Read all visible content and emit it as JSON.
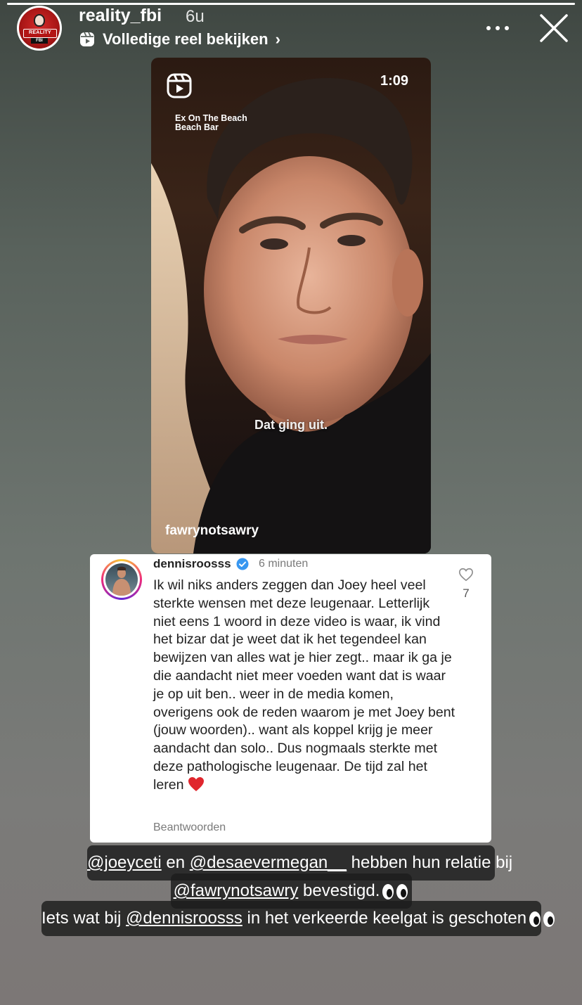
{
  "header": {
    "username": "reality_fbi",
    "time_ago": "6u",
    "reel_link_label": "Volledige reel bekijken",
    "avatar_text": "REALITY",
    "avatar_subtext": "FBI"
  },
  "reel": {
    "duration": "1:09",
    "location_line1": "Ex On The Beach",
    "location_line2": "Beach Bar",
    "caption": "Dat ging uit.",
    "handle": "fawrynotsawry"
  },
  "comment": {
    "username": "dennisroosss",
    "time": "6 minuten",
    "text": "Ik wil niks anders zeggen dan Joey heel veel sterkte wensen met deze leugenaar. Letterlijk niet eens 1 woord in deze video is waar, ik vind het bizar dat je weet dat ik het tegendeel kan bewijzen van alles wat je hier zegt.. maar ik ga je die aandacht niet meer voeden want dat is waar je op uit ben.. weer in de media komen, overigens ook de reden waarom je met Joey bent (jouw woorden).. want als koppel krijg je meer aandacht dan solo.. Dus nogmaals sterkte met deze pathologische leugenaar. De tijd zal het leren",
    "likes": "7",
    "reply_label": "Beantwoorden"
  },
  "captions": {
    "line1": {
      "mention1": "@joeyceti",
      "text1": " en ",
      "mention2": "@desaevermegan__",
      "text2": " hebben hun relatie bij"
    },
    "line2": {
      "mention": "@fawrynotsawry",
      "text": " bevestigd."
    },
    "line3": {
      "text1": "Iets wat bij ",
      "mention": "@dennisroosss",
      "text2": " in het verkeerde keelgat is geschoten"
    }
  },
  "icons": {
    "verified": "verified-badge-icon",
    "heart": "heart-outline-icon",
    "reels": "reels-icon",
    "more": "more-horizontal-icon",
    "close": "close-icon",
    "eyes": "eyes-emoji",
    "red_heart": "red-heart-emoji"
  },
  "colors": {
    "verified_blue": "#3897f0",
    "heart_red": "#e0262d",
    "avatar_red": "#b31515"
  }
}
